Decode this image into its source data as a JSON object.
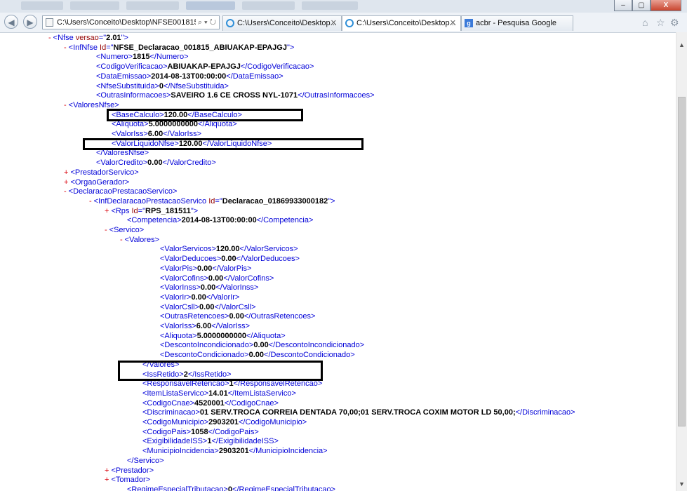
{
  "browser": {
    "address": "C:\\Users\\Conceito\\Desktop\\NFSE001815.",
    "address_controls": "⌕ ▾ ↻",
    "tabs": [
      {
        "label": "C:\\Users\\Conceito\\Desktop...",
        "active": false
      },
      {
        "label": "C:\\Users\\Conceito\\Desktop...",
        "active": true
      },
      {
        "label": "acbr - Pesquisa Google",
        "active": false
      }
    ],
    "window_buttons": [
      "–",
      "▢",
      "X"
    ],
    "nav_back": "◀",
    "nav_forward": "▶",
    "right_icons": [
      "home-icon",
      "star-icon",
      "gear-icon"
    ]
  },
  "xml": {
    "lines": [
      {
        "i": 0,
        "t": "-",
        "k": "open",
        "n": "Nfse",
        "a": [
          [
            "versao",
            "2.01"
          ]
        ]
      },
      {
        "i": 1,
        "t": "-",
        "k": "open",
        "n": "InfNfse",
        "a": [
          [
            "Id",
            "NFSE_Declaracao_001815_ABIUAKAP-EPAJGJ"
          ]
        ]
      },
      {
        "i": 2,
        "k": "el",
        "n": "Numero",
        "v": "1815"
      },
      {
        "i": 2,
        "k": "el",
        "n": "CodigoVerificacao",
        "v": "ABIUAKAP-EPAJGJ"
      },
      {
        "i": 2,
        "k": "el",
        "n": "DataEmissao",
        "v": "2014-08-13T00:00:00"
      },
      {
        "i": 2,
        "k": "el",
        "n": "NfseSubstituida",
        "v": "0"
      },
      {
        "i": 2,
        "k": "el",
        "n": "OutrasInformacoes",
        "v": "SAVEIRO 1.6 CE CROSS NYL-1071"
      },
      {
        "i": 1,
        "t": "-",
        "k": "open",
        "n": "ValoresNfse"
      },
      {
        "i": 3,
        "k": "el",
        "n": "BaseCalculo",
        "v": "120.00"
      },
      {
        "i": 3,
        "k": "el",
        "n": "Aliquota",
        "v": "5.0000000000"
      },
      {
        "i": 3,
        "k": "el",
        "n": "ValorIss",
        "v": "6.00"
      },
      {
        "i": 3,
        "k": "el",
        "n": "ValorLiquidoNfse",
        "v": "120.00"
      },
      {
        "i": 2,
        "k": "close",
        "n": "ValoresNfse"
      },
      {
        "i": 2,
        "k": "el",
        "n": "ValorCredito",
        "v": "0.00"
      },
      {
        "i": 1,
        "t": "+",
        "k": "open",
        "n": "PrestadorServico"
      },
      {
        "i": 1,
        "t": "+",
        "k": "open",
        "n": "OrgaoGerador"
      },
      {
        "i": 1,
        "t": "-",
        "k": "open",
        "n": "DeclaracaoPrestacaoServico"
      },
      {
        "i": 2,
        "t": "-",
        "k": "open",
        "n": "InfDeclaracaoPrestacaoServico",
        "a": [
          [
            "Id",
            "Declaracao_01869933000182"
          ]
        ]
      },
      {
        "i": 3,
        "t": "+",
        "k": "open",
        "n": "Rps",
        "a": [
          [
            "Id",
            "RPS_181511"
          ]
        ]
      },
      {
        "i": 4,
        "k": "el",
        "n": "Competencia",
        "v": "2014-08-13T00:00:00"
      },
      {
        "i": 3,
        "t": "-",
        "k": "open",
        "n": "Servico"
      },
      {
        "i": 4,
        "t": "-",
        "k": "open",
        "n": "Valores"
      },
      {
        "i": 6,
        "k": "el",
        "n": "ValorServicos",
        "v": "120.00"
      },
      {
        "i": 6,
        "k": "el",
        "n": "ValorDeducoes",
        "v": "0.00"
      },
      {
        "i": 6,
        "k": "el",
        "n": "ValorPis",
        "v": "0.00"
      },
      {
        "i": 6,
        "k": "el",
        "n": "ValorCofins",
        "v": "0.00"
      },
      {
        "i": 6,
        "k": "el",
        "n": "ValorInss",
        "v": "0.00"
      },
      {
        "i": 6,
        "k": "el",
        "n": "ValorIr",
        "v": "0.00"
      },
      {
        "i": 6,
        "k": "el",
        "n": "ValorCsll",
        "v": "0.00"
      },
      {
        "i": 6,
        "k": "el",
        "n": "OutrasRetencoes",
        "v": "0.00"
      },
      {
        "i": 6,
        "k": "el",
        "n": "ValorIss",
        "v": "6.00"
      },
      {
        "i": 6,
        "k": "el",
        "n": "Aliquota",
        "v": "5.0000000000"
      },
      {
        "i": 6,
        "k": "el",
        "n": "DescontoIncondicionado",
        "v": "0.00"
      },
      {
        "i": 6,
        "k": "el",
        "n": "DescontoCondicionado",
        "v": "0.00"
      },
      {
        "i": 5,
        "k": "close",
        "n": "Valores"
      },
      {
        "i": 5,
        "k": "el",
        "n": "IssRetido",
        "v": "2"
      },
      {
        "i": 5,
        "k": "el",
        "n": "ResponsavelRetencao",
        "v": "1"
      },
      {
        "i": 5,
        "k": "el",
        "n": "ItemListaServico",
        "v": "14.01"
      },
      {
        "i": 5,
        "k": "el",
        "n": "CodigoCnae",
        "v": "4520001"
      },
      {
        "i": 5,
        "k": "el",
        "n": "Discriminacao",
        "v": "01 SERV.TROCA CORREIA DENTADA 70,00;01 SERV.TROCA COXIM MOTOR LD 50,00;"
      },
      {
        "i": 5,
        "k": "el",
        "n": "CodigoMunicipio",
        "v": "2903201"
      },
      {
        "i": 5,
        "k": "el",
        "n": "CodigoPais",
        "v": "1058"
      },
      {
        "i": 5,
        "k": "el",
        "n": "ExigibilidadeISS",
        "v": "1"
      },
      {
        "i": 5,
        "k": "el",
        "n": "MunicipioIncidencia",
        "v": "2903201"
      },
      {
        "i": 4,
        "k": "close",
        "n": "Servico"
      },
      {
        "i": 3,
        "t": "+",
        "k": "open",
        "n": "Prestador"
      },
      {
        "i": 3,
        "t": "+",
        "k": "open",
        "n": "Tomador"
      },
      {
        "i": 4,
        "k": "el",
        "n": "RegimeEspecialTributacao",
        "v": "0"
      }
    ]
  }
}
